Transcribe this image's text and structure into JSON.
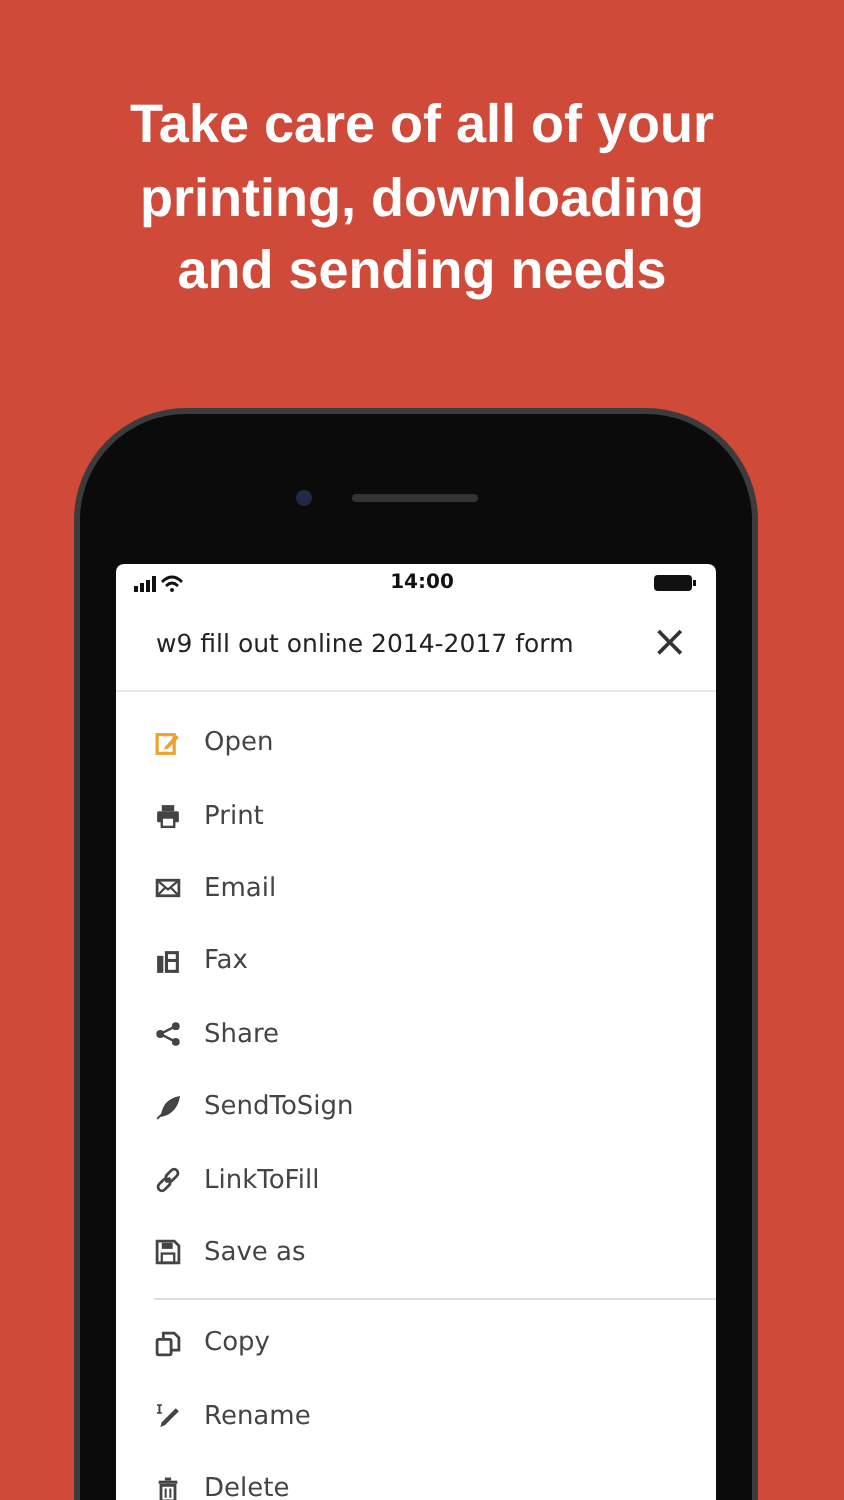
{
  "headline": "Take care of all of your\nprinting, downloading\nand sending needs",
  "status_bar": {
    "time": "14:00"
  },
  "sheet": {
    "title": "w9 fill out online 2014-2017 form",
    "close": "×"
  },
  "sections": [
    [
      {
        "label": "Open",
        "color": "#f0a02c"
      },
      {
        "label": "Print",
        "color": "#444444"
      },
      {
        "label": "Email",
        "color": "#444444"
      },
      {
        "label": "Fax",
        "color": "#444444"
      },
      {
        "label": "Share",
        "color": "#444444"
      },
      {
        "label": "SendToSign",
        "color": "#444444"
      },
      {
        "label": "LinkToFill",
        "color": "#444444"
      },
      {
        "label": "Save as",
        "color": "#444444"
      }
    ],
    [
      {
        "label": "Copy",
        "color": "#444444"
      },
      {
        "label": "Rename",
        "color": "#444444"
      },
      {
        "label": "Delete",
        "color": "#444444"
      }
    ]
  ]
}
